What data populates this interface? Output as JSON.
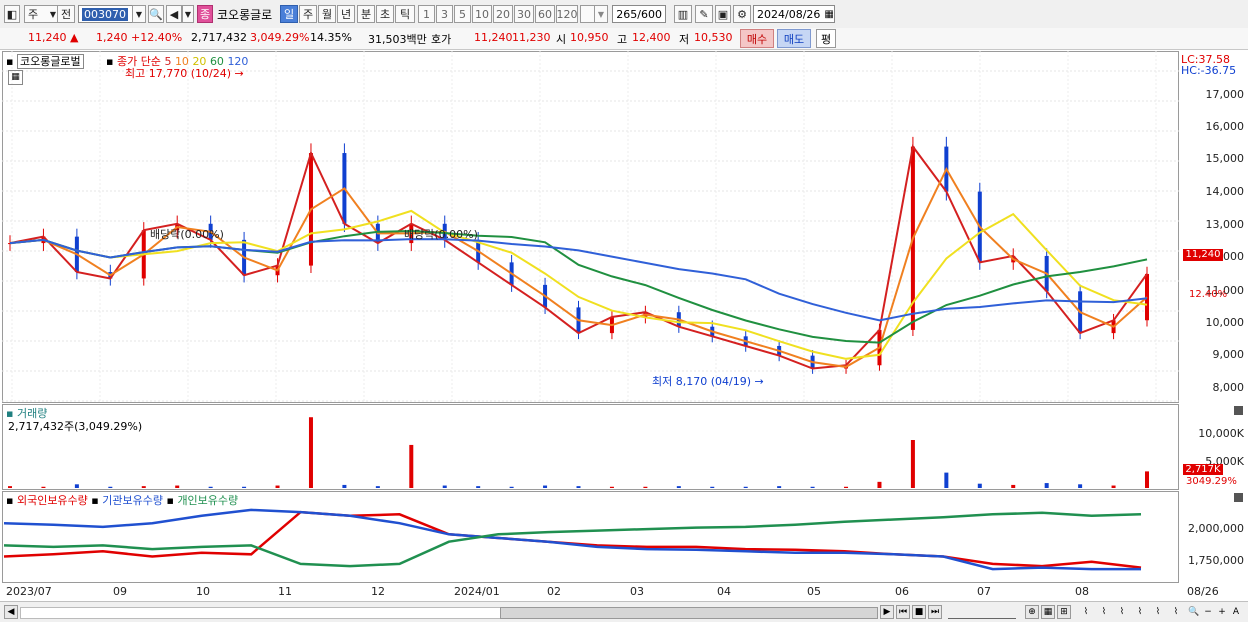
{
  "toolbar": {
    "mode": "주",
    "prev_label": "전",
    "stock_code": "003070",
    "stock_name": "코오롱글로",
    "jong_label": "종",
    "periods": [
      "일",
      "주",
      "월",
      "년",
      "분",
      "초",
      "틱"
    ],
    "active_period": "일",
    "intervals": [
      "1",
      "3",
      "5",
      "10",
      "20",
      "30",
      "60",
      "120"
    ],
    "count_value": "265",
    "count_total": "/600",
    "date_value": "2024/08/26"
  },
  "info": {
    "price": "11,240",
    "change": "1,240",
    "change_pct": "+12.40%",
    "volume": "2,717,432",
    "volume_pct": "3,049.29%",
    "turnover": "14.35%",
    "amount": "31,503백만",
    "bid_label": "호가",
    "ask_price": "11,240",
    "bid_price": "11,230",
    "open_label": "시",
    "open": "10,950",
    "high_label": "고",
    "high": "12,400",
    "low_label": "저",
    "low": "10,530",
    "buy_label": "매수",
    "sell_label": "매도",
    "even_label": "평"
  },
  "price_panel": {
    "stock_legend": "코오롱글로벌",
    "ma_label": "종가 단순",
    "ma_periods": [
      "5",
      "10",
      "20",
      "60",
      "120"
    ],
    "ma_colors": [
      "#d42020",
      "#f08020",
      "#f0e020",
      "#209040",
      "#3060d8"
    ],
    "high_note": "최고 17,770 (10/24)",
    "low_note": "최저 8,170 (04/19)",
    "dividend_note_1": "배당락(0.00%)",
    "dividend_note_2": "배당락(0.00%)",
    "lc_label": "LC:37.58",
    "hc_label": "HC:-36.75",
    "price_tag": "11,240",
    "pct_tag": "12.40%",
    "y_ticks": [
      "17,000",
      "16,000",
      "15,000",
      "14,000",
      "13,000",
      "12,000",
      "11,000",
      "10,000",
      "9,000",
      "8,000"
    ]
  },
  "volume_panel": {
    "title": "거래량",
    "value_label": "2,717,432주(3,049.29%)",
    "y_ticks": [
      "10,000K",
      "5,000K"
    ],
    "tag_value": "2,717K",
    "tag_pct": "3049.29%"
  },
  "holdings_panel": {
    "legend": [
      "외국인보유수량",
      "기관보유수량",
      "개인보유수량"
    ],
    "legend_colors": [
      "#e00000",
      "#2050d0",
      "#209050"
    ],
    "y_ticks": [
      "2,000,000",
      "1,750,000"
    ]
  },
  "x_axis": [
    "2023/07",
    "09",
    "10",
    "11",
    "12",
    "2024/01",
    "02",
    "03",
    "04",
    "05",
    "06",
    "07",
    "08",
    "08/26"
  ],
  "chart_data": {
    "type": "line",
    "title": "코오롱글로벌",
    "series": [
      {
        "name": "종가",
        "values": [
          12200,
          12400,
          11300,
          11100,
          12600,
          12800,
          12300,
          11200,
          11500,
          15000,
          12800,
          12200,
          12800,
          12300,
          11600,
          10900,
          10200,
          9400,
          9900,
          10050,
          9600,
          9300,
          9000,
          8700,
          8300,
          8400,
          9500,
          15200,
          13800,
          11600,
          11800,
          10700,
          9400,
          9800,
          11240
        ]
      },
      {
        "name": "거래량",
        "values": [
          0.3,
          0.2,
          0.6,
          0.2,
          0.3,
          0.4,
          0.2,
          0.2,
          0.4,
          11.5,
          0.5,
          0.3,
          7.0,
          0.4,
          0.3,
          0.2,
          0.4,
          0.3,
          0.2,
          0.2,
          0.3,
          0.2,
          0.2,
          0.3,
          0.2,
          0.2,
          1.0,
          7.8,
          2.5,
          0.7,
          0.5,
          0.8,
          0.6,
          0.4,
          2.7
        ]
      }
    ],
    "ylim": [
      7600,
      17800
    ]
  }
}
